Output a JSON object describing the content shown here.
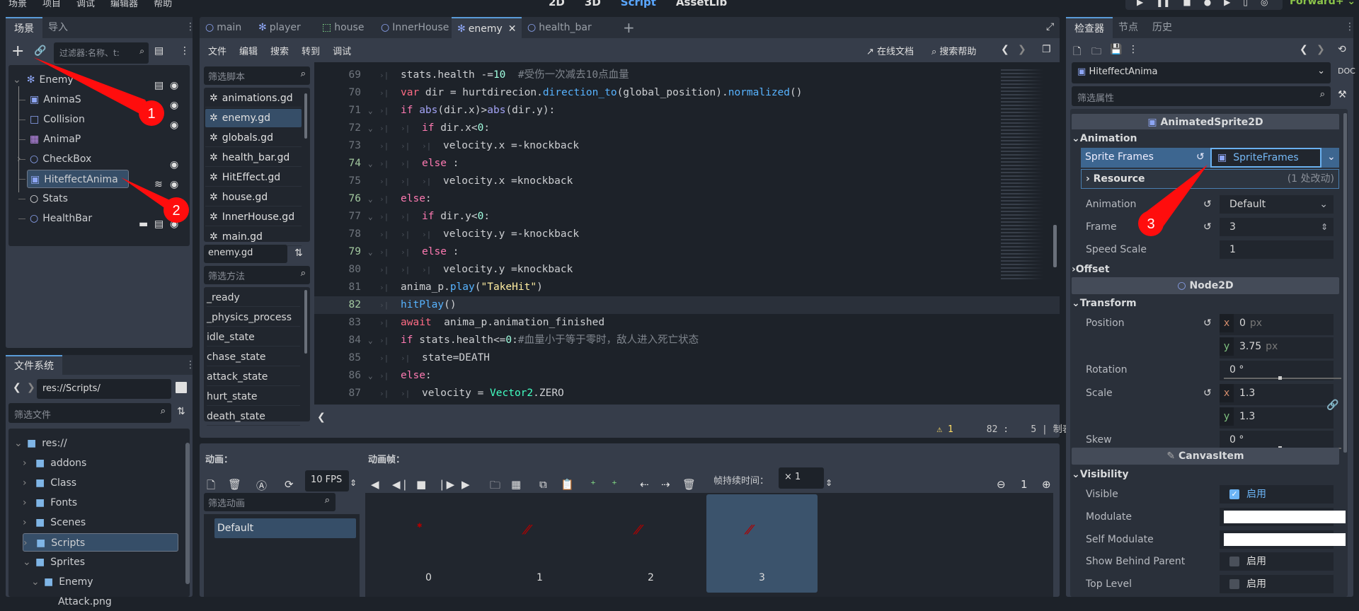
{
  "menu": {
    "items": [
      "场景",
      "项目",
      "调试",
      "编辑器",
      "帮助"
    ],
    "workspaces": [
      "2D",
      "3D",
      "Script",
      "AssetLib"
    ],
    "active_workspace": "Script",
    "renderer": "Forward+"
  },
  "scene_dock": {
    "tabs": [
      "场景",
      "导入"
    ],
    "filter_placeholder": "过滤器:名称、t:",
    "tree": [
      {
        "name": "Enemy",
        "icon": "character-body-icon",
        "level": 0,
        "expanded": true,
        "badges": [
          "script-icon",
          "eye-icon"
        ]
      },
      {
        "name": "AnimaS",
        "icon": "animated-sprite-icon",
        "level": 1,
        "badges": [
          "eye-icon"
        ]
      },
      {
        "name": "Collision",
        "icon": "collision-shape-icon",
        "level": 1,
        "badges": [
          "eye-icon"
        ]
      },
      {
        "name": "AnimaP",
        "icon": "animation-player-icon",
        "level": 1,
        "badges": []
      },
      {
        "name": "CheckBox",
        "icon": "area-icon",
        "level": 1,
        "collapsed": true,
        "badges": [
          "eye-icon"
        ]
      },
      {
        "name": "HiteffectAnima",
        "icon": "animated-sprite-icon",
        "level": 1,
        "selected": true,
        "badges": [
          "signal-icon",
          "eye-icon"
        ]
      },
      {
        "name": "Stats",
        "icon": "node-icon",
        "level": 1,
        "badges": [
          "script-icon"
        ]
      },
      {
        "name": "HealthBar",
        "icon": "node2d-icon",
        "level": 1,
        "badges": [
          "clapper-icon",
          "script-icon",
          "eye-icon"
        ]
      }
    ]
  },
  "filesystem": {
    "title": "文件系统",
    "path": "res://Scripts/",
    "filter_placeholder": "筛选文件",
    "tree": [
      {
        "name": "res://",
        "level": 0,
        "expanded": true
      },
      {
        "name": "addons",
        "level": 1
      },
      {
        "name": "Class",
        "level": 1
      },
      {
        "name": "Fonts",
        "level": 1
      },
      {
        "name": "Scenes",
        "level": 1
      },
      {
        "name": "Scripts",
        "level": 1,
        "selected": true
      },
      {
        "name": "Sprites",
        "level": 1,
        "expanded": true
      },
      {
        "name": "Enemy",
        "level": 2,
        "expanded": true
      },
      {
        "name": "Attack.png",
        "level": 3,
        "file": true
      }
    ]
  },
  "editor_tabs": [
    {
      "label": "main",
      "icon": "node2d-icon"
    },
    {
      "label": "player",
      "icon": "character-body-icon"
    },
    {
      "label": "house",
      "icon": "control-icon"
    },
    {
      "label": "InnerHouse",
      "icon": "node2d-icon"
    },
    {
      "label": "enemy",
      "icon": "character-body-icon",
      "active": true
    },
    {
      "label": "health_bar",
      "icon": "node2d-icon"
    }
  ],
  "script_menu": {
    "items": [
      "文件",
      "编辑",
      "搜索",
      "转到",
      "调试"
    ],
    "online_docs": "在线文档",
    "search_help": "搜索帮助"
  },
  "script_list": {
    "filter_placeholder": "筛选脚本",
    "scripts": [
      "animations.gd",
      "enemy.gd",
      "globals.gd",
      "health_bar.gd",
      "HitEffect.gd",
      "house.gd",
      "InnerHouse.gd",
      "main.gd"
    ],
    "selected": "enemy.gd",
    "current": "enemy.gd",
    "method_filter_placeholder": "筛选方法",
    "methods": [
      "_ready",
      "_physics_process",
      "idle_state",
      "chase_state",
      "attack_state",
      "hurt_state",
      "death_state"
    ]
  },
  "code": {
    "current_line": 82,
    "lines": [
      {
        "n": "69",
        "i": 0,
        "tokens": [
          [
            "stats.health -=",
            "p"
          ],
          [
            "10",
            "n"
          ],
          [
            "  #受伤一次减去10点血量",
            "c"
          ]
        ]
      },
      {
        "n": "70",
        "i": 0,
        "tokens": [
          [
            "var",
            "kr"
          ],
          [
            " dir = hurtdirecion.",
            "p"
          ],
          [
            "direction_to",
            "f"
          ],
          [
            "(global_position).",
            "p"
          ],
          [
            "normalized",
            "f"
          ],
          [
            "()",
            "p"
          ]
        ]
      },
      {
        "n": "71",
        "i": 0,
        "fold": true,
        "tokens": [
          [
            "if",
            "k"
          ],
          [
            " ",
            "p"
          ],
          [
            "abs",
            "b"
          ],
          [
            "(dir.x)>",
            "p"
          ],
          [
            "abs",
            "b"
          ],
          [
            "(dir.y):",
            "p"
          ]
        ]
      },
      {
        "n": "72",
        "i": 1,
        "fold": true,
        "tokens": [
          [
            "if",
            "k"
          ],
          [
            " dir.x<",
            "p"
          ],
          [
            "0",
            "n"
          ],
          [
            ":",
            "p"
          ]
        ]
      },
      {
        "n": "73",
        "i": 2,
        "tokens": [
          [
            "velocity.x =-knockback",
            "p"
          ]
        ]
      },
      {
        "n": "74",
        "i": 1,
        "fold": true,
        "mod": true,
        "tokens": [
          [
            "else",
            "k"
          ],
          [
            " :",
            "p"
          ]
        ]
      },
      {
        "n": "75",
        "i": 2,
        "tokens": [
          [
            "velocity.x =knockback",
            "p"
          ]
        ]
      },
      {
        "n": "76",
        "i": 0,
        "fold": true,
        "mod": true,
        "tokens": [
          [
            "else",
            "k"
          ],
          [
            ":",
            "p"
          ]
        ]
      },
      {
        "n": "77",
        "i": 1,
        "fold": true,
        "tokens": [
          [
            "if",
            "k"
          ],
          [
            " dir.y<",
            "p"
          ],
          [
            "0",
            "n"
          ],
          [
            ":",
            "p"
          ]
        ]
      },
      {
        "n": "78",
        "i": 2,
        "tokens": [
          [
            "velocity.y =-knockback",
            "p"
          ]
        ]
      },
      {
        "n": "79",
        "i": 1,
        "fold": true,
        "mod": true,
        "tokens": [
          [
            "else",
            "k"
          ],
          [
            " :",
            "p"
          ]
        ]
      },
      {
        "n": "80",
        "i": 2,
        "tokens": [
          [
            "velocity.y =knockback",
            "p"
          ]
        ]
      },
      {
        "n": "81",
        "i": 0,
        "tokens": [
          [
            "anima_p.",
            "p"
          ],
          [
            "play",
            "f"
          ],
          [
            "(",
            "p"
          ],
          [
            "\"TakeHit\"",
            "s"
          ],
          [
            ")",
            "p"
          ]
        ]
      },
      {
        "n": "82",
        "i": 0,
        "mod": true,
        "tokens": [
          [
            "hitPlay",
            "f"
          ],
          [
            "()",
            "p"
          ]
        ]
      },
      {
        "n": "83",
        "i": 0,
        "tokens": [
          [
            "await",
            "kr"
          ],
          [
            "  anima_p.animation_finished",
            "p"
          ]
        ]
      },
      {
        "n": "84",
        "i": 0,
        "fold": true,
        "tokens": [
          [
            "if",
            "k"
          ],
          [
            " stats.health<=",
            "p"
          ],
          [
            "0",
            "n"
          ],
          [
            ":",
            "p"
          ],
          [
            "#血量小于等于零时，敌人进入死亡状态",
            "c"
          ]
        ]
      },
      {
        "n": "85",
        "i": 1,
        "tokens": [
          [
            "state=DEATH",
            "p"
          ]
        ]
      },
      {
        "n": "86",
        "i": 0,
        "fold": true,
        "tokens": [
          [
            "else",
            "k"
          ],
          [
            ":",
            "p"
          ]
        ]
      },
      {
        "n": "87",
        "i": 1,
        "tokens": [
          [
            "velocity = ",
            "p"
          ],
          [
            "Vector2",
            "t"
          ],
          [
            ".ZERO",
            "p"
          ]
        ]
      }
    ]
  },
  "status": {
    "warnings": "1",
    "line": "82",
    "sep": ":",
    "col": "5",
    "indent": "制表符"
  },
  "anim_panel": {
    "animations_label": "动画：",
    "frames_label": "动画帧：",
    "fps": "10 FPS",
    "duration_label": "帧持续时间：",
    "duration": "× 1",
    "filter_placeholder": "筛选动画",
    "animations": [
      "Default"
    ],
    "frames": [
      "0",
      "1",
      "2",
      "3"
    ],
    "selected_frame": 3,
    "zoom_reset": "1"
  },
  "inspector": {
    "tabs": [
      "检查器",
      "节点",
      "历史"
    ],
    "object": "HiteffectAnima",
    "filter_placeholder": "筛选属性",
    "class1": "AnimatedSprite2D",
    "sec_animation": "Animation",
    "sprite_frames_label": "Sprite Frames",
    "sprite_frames_value": "SpriteFrames",
    "resource_label": "Resource",
    "resource_changes": "(1 处改动)",
    "animation_label": "Animation",
    "animation_value": "Default",
    "frame_label": "Frame",
    "frame_value": "3",
    "speed_label": "Speed Scale",
    "speed_value": "1",
    "sec_offset": "Offset",
    "class2": "Node2D",
    "sec_transform": "Transform",
    "position_label": "Position",
    "pos_x": "0",
    "pos_y": "3.75",
    "unit_px": "px",
    "rotation_label": "Rotation",
    "rotation_value": "0 °",
    "scale_label": "Scale",
    "scale_x": "1.3",
    "scale_y": "1.3",
    "skew_label": "Skew",
    "skew_value": "0 °",
    "class3": "CanvasItem",
    "sec_visibility": "Visibility",
    "visible_label": "Visible",
    "visible_checked": true,
    "enable_text": "启用",
    "modulate_label": "Modulate",
    "modulate_color": "#ffffff",
    "self_modulate_label": "Self Modulate",
    "self_modulate_color": "#ffffff",
    "show_behind_label": "Show Behind Parent",
    "show_behind_checked": false,
    "top_level_label": "Top Level",
    "top_level_checked": false,
    "axis_x": "x",
    "axis_y": "y"
  },
  "annotations": [
    "1",
    "2",
    "3"
  ],
  "colors": {
    "accent": "#5a9bd8",
    "annotation": "#ff0000",
    "selected": "#364e68",
    "renderer": "#8bc34a"
  }
}
